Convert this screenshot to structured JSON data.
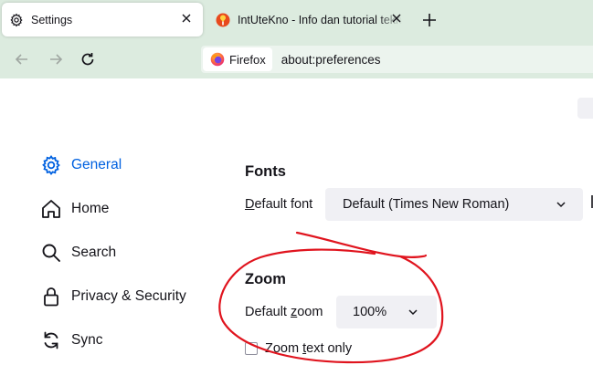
{
  "tabs": [
    {
      "title": "Settings",
      "icon": "gear-icon",
      "active": true
    },
    {
      "title": "IntUteKno - Info dan tutorial teknologi",
      "icon": "intutekno-favicon-icon",
      "active": false
    }
  ],
  "nav": {
    "identity_label": "Firefox",
    "url": "about:preferences"
  },
  "sidebar": {
    "items": [
      {
        "label": "General",
        "icon": "gear-icon",
        "selected": true
      },
      {
        "label": "Home",
        "icon": "home-icon",
        "selected": false
      },
      {
        "label": "Search",
        "icon": "search-icon",
        "selected": false
      },
      {
        "label": "Privacy & Security",
        "icon": "lock-icon",
        "selected": false
      },
      {
        "label": "Sync",
        "icon": "sync-icon",
        "selected": false
      }
    ]
  },
  "fonts": {
    "heading": "Fonts",
    "default_font_label_accesskey": "D",
    "default_font_label_rest": "efault font",
    "default_font_value": "Default (Times New Roman)"
  },
  "zoom": {
    "heading": "Zoom",
    "default_zoom_label_pre": "Default ",
    "default_zoom_label_accesskey": "z",
    "default_zoom_label_post": "oom",
    "default_zoom_value": "100%",
    "zoom_text_pre": "Zoom ",
    "zoom_text_accesskey": "t",
    "zoom_text_post": "ext only",
    "zoom_text_checked": false
  },
  "colors": {
    "accent": "#0061e0",
    "chrome": "#dcebdf",
    "annotation": "#e0141e"
  }
}
